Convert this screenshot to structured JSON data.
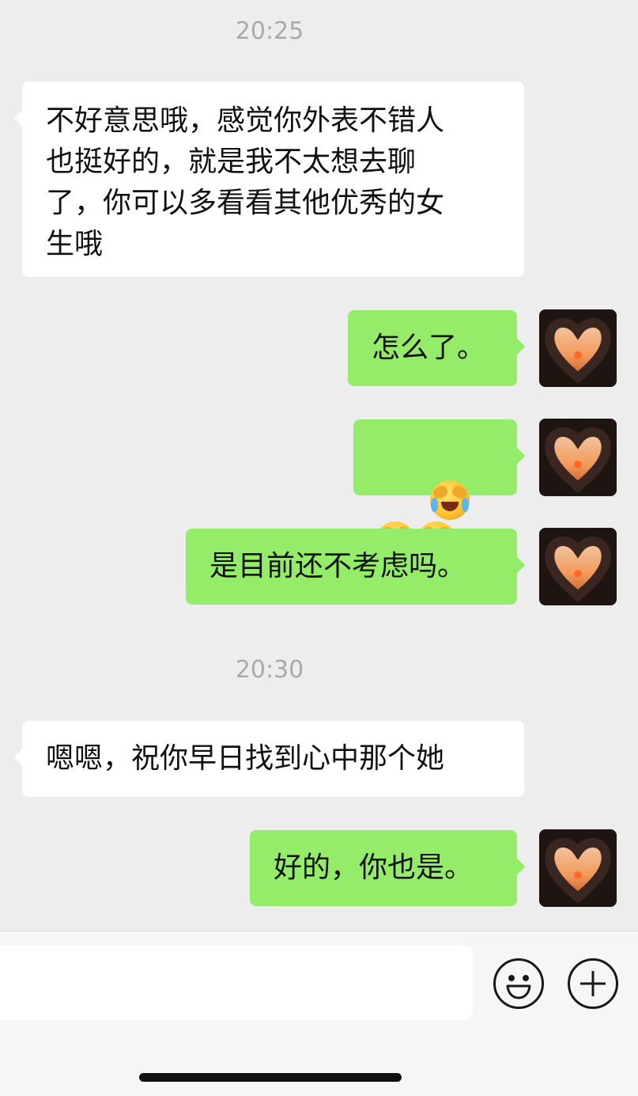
{
  "messages": [
    {
      "type": "time",
      "text": "20:25"
    },
    {
      "type": "incoming",
      "text": "不好意思哦，感觉你外表不错人\n也挺好的，就是我不太想去聊\n了，你可以多看看其他优秀的女\n生哦"
    },
    {
      "type": "outgoing",
      "text": "怎么了。"
    },
    {
      "type": "outgoing",
      "emoji": "crying-laughing-emoji",
      "count": 3
    },
    {
      "type": "outgoing",
      "text": "是目前还不考虑吗。"
    },
    {
      "type": "time",
      "text": "20:30"
    },
    {
      "type": "incoming",
      "text": "嗯嗯，祝你早日找到心中那个她"
    },
    {
      "type": "outgoing",
      "text": "好的，你也是。"
    }
  ],
  "colors": {
    "background": "#ededed",
    "incoming_bubble": "#ffffff",
    "outgoing_bubble": "#95ec69",
    "timestamp": "#aaaaaa"
  },
  "input_bar": {
    "input_value": "",
    "icons": [
      "microphone-icon",
      "emoji-icon",
      "plus-icon"
    ]
  }
}
